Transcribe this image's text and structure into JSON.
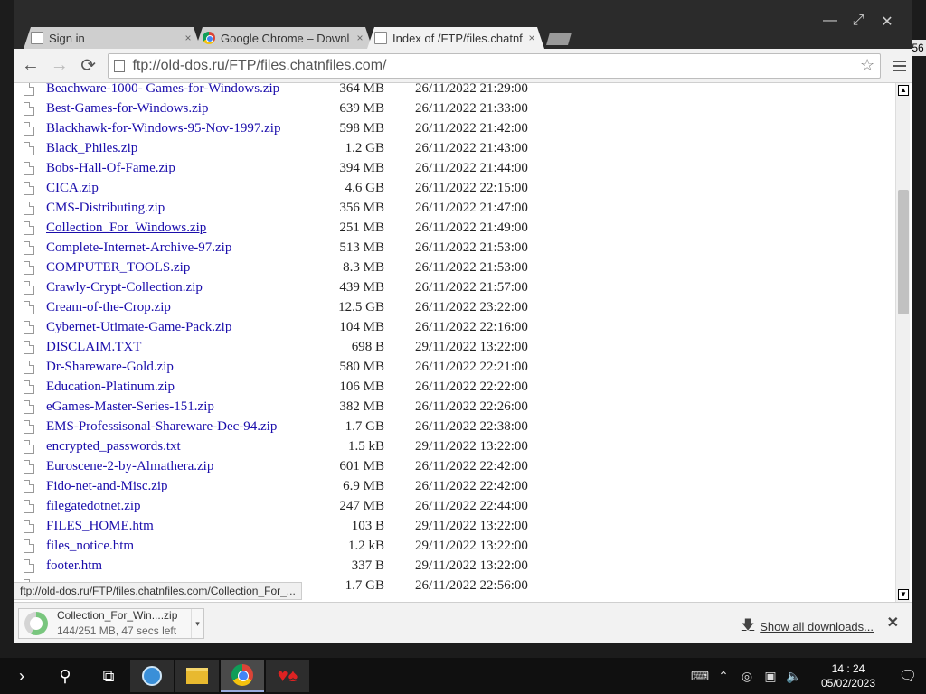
{
  "window": {
    "minimize": "—",
    "maximize": "⤢",
    "close": "✕"
  },
  "tabs": [
    {
      "label": "Sign in",
      "icon": "page-icon",
      "close": "×"
    },
    {
      "label": "Google Chrome – Downl",
      "icon": "chrome-icon",
      "close": "×"
    },
    {
      "label": "Index of /FTP/files.chatnf",
      "icon": "page-icon",
      "close": "×"
    }
  ],
  "toolbar": {
    "back": "←",
    "forward": "→",
    "reload": "⟳",
    "url": "ftp://old-dos.ru/FTP/files.chatnfiles.com/",
    "star": "☆"
  },
  "files": [
    {
      "name": "Beachware-1000- Games-for-Windows.zip",
      "size": "364 MB",
      "date": "26/11/2022 21:29:00"
    },
    {
      "name": "Best-Games-for-Windows.zip",
      "size": "639 MB",
      "date": "26/11/2022 21:33:00"
    },
    {
      "name": "Blackhawk-for-Windows-95-Nov-1997.zip",
      "size": "598 MB",
      "date": "26/11/2022 21:42:00"
    },
    {
      "name": "Black_Philes.zip",
      "size": "1.2 GB",
      "date": "26/11/2022 21:43:00"
    },
    {
      "name": "Bobs-Hall-Of-Fame.zip",
      "size": "394 MB",
      "date": "26/11/2022 21:44:00"
    },
    {
      "name": "CICA.zip",
      "size": "4.6 GB",
      "date": "26/11/2022 22:15:00"
    },
    {
      "name": "CMS-Distributing.zip",
      "size": "356 MB",
      "date": "26/11/2022 21:47:00"
    },
    {
      "name": "Collection_For_Windows.zip",
      "size": "251 MB",
      "date": "26/11/2022 21:49:00"
    },
    {
      "name": "Complete-Internet-Archive-97.zip",
      "size": "513 MB",
      "date": "26/11/2022 21:53:00"
    },
    {
      "name": "COMPUTER_TOOLS.zip",
      "size": "8.3 MB",
      "date": "26/11/2022 21:53:00"
    },
    {
      "name": "Crawly-Crypt-Collection.zip",
      "size": "439 MB",
      "date": "26/11/2022 21:57:00"
    },
    {
      "name": "Cream-of-the-Crop.zip",
      "size": "12.5 GB",
      "date": "26/11/2022 23:22:00"
    },
    {
      "name": "Cybernet-Utimate-Game-Pack.zip",
      "size": "104 MB",
      "date": "26/11/2022 22:16:00"
    },
    {
      "name": "DISCLAIM.TXT",
      "size": "698 B",
      "date": "29/11/2022 13:22:00"
    },
    {
      "name": "Dr-Shareware-Gold.zip",
      "size": "580 MB",
      "date": "26/11/2022 22:21:00"
    },
    {
      "name": "Education-Platinum.zip",
      "size": "106 MB",
      "date": "26/11/2022 22:22:00"
    },
    {
      "name": "eGames-Master-Series-151.zip",
      "size": "382 MB",
      "date": "26/11/2022 22:26:00"
    },
    {
      "name": "EMS-Professisonal-Shareware-Dec-94.zip",
      "size": "1.7 GB",
      "date": "26/11/2022 22:38:00"
    },
    {
      "name": "encrypted_passwords.txt",
      "size": "1.5 kB",
      "date": "29/11/2022 13:22:00"
    },
    {
      "name": "Euroscene-2-by-Almathera.zip",
      "size": "601 MB",
      "date": "26/11/2022 22:42:00"
    },
    {
      "name": "Fido-net-and-Misc.zip",
      "size": "6.9 MB",
      "date": "26/11/2022 22:42:00"
    },
    {
      "name": "filegatedotnet.zip",
      "size": "247 MB",
      "date": "26/11/2022 22:44:00"
    },
    {
      "name": "FILES_HOME.htm",
      "size": "103 B",
      "date": "29/11/2022 13:22:00"
    },
    {
      "name": "files_notice.htm",
      "size": "1.2 kB",
      "date": "29/11/2022 13:22:00"
    },
    {
      "name": "footer.htm",
      "size": "337 B",
      "date": "29/11/2022 13:22:00"
    },
    {
      "name": "",
      "size": "1.7 GB",
      "date": "26/11/2022 22:56:00"
    }
  ],
  "hovered_index": 7,
  "status_url": "ftp://old-dos.ru/FTP/files.chatnfiles.com/Collection_For_...",
  "download": {
    "filename": "Collection_For_Win....zip",
    "progress": "144/251 MB, 47 secs left",
    "fraction": 0.574,
    "caret": "▾",
    "show_all": "Show all downloads...",
    "close": "✕"
  },
  "taskbar": {
    "clock_time": "14 : 24",
    "clock_date": "05/02/2023"
  },
  "desktop": {
    "right_edge": "56"
  }
}
